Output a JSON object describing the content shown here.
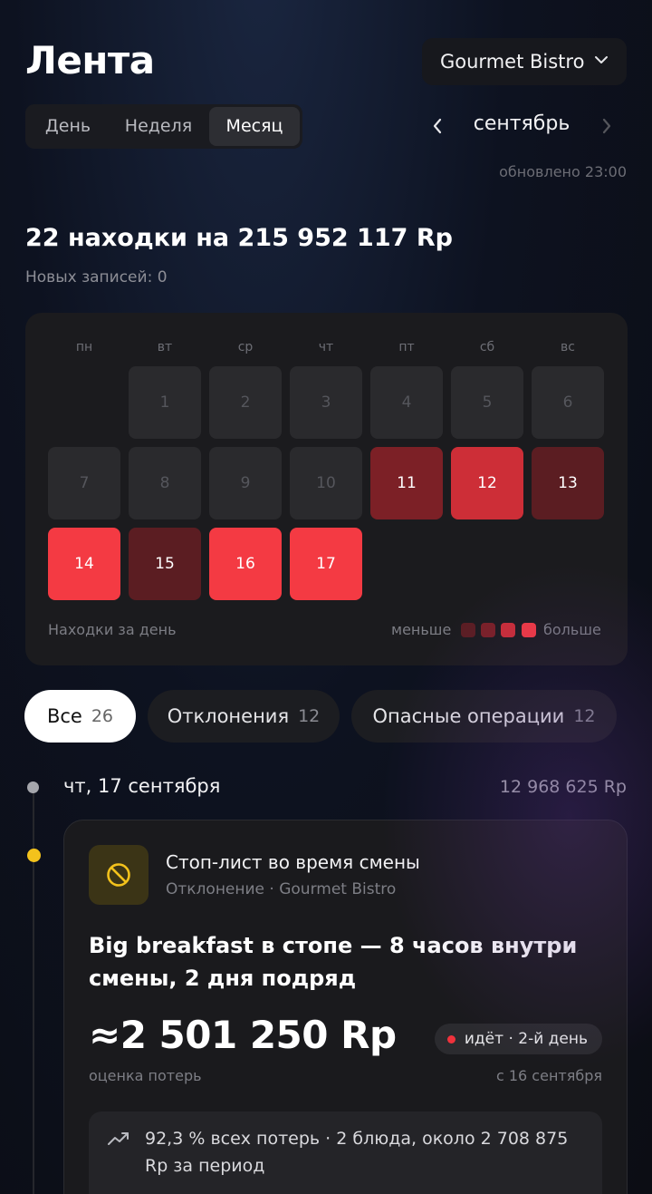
{
  "header": {
    "title": "Лента",
    "venue": "Gourmet Bistro"
  },
  "period_tabs": [
    "День",
    "Неделя",
    "Месяц"
  ],
  "active_period": "Месяц",
  "month": "сентябрь",
  "updated": "обновлено 23:00",
  "summary": {
    "headline": "22 находки на 215 952 117 Rp",
    "new_records": "Новых записей: 0"
  },
  "calendar": {
    "weekdays": [
      "пн",
      "вт",
      "ср",
      "чт",
      "пт",
      "сб",
      "вс"
    ],
    "days": [
      "1",
      "2",
      "3",
      "4",
      "5",
      "6",
      "7",
      "8",
      "9",
      "10",
      "11",
      "12",
      "13",
      "14",
      "15",
      "16",
      "17"
    ],
    "footer_label": "Находки за день",
    "legend_less": "меньше",
    "legend_more": "больше",
    "heat_colors": [
      "#5b1d22",
      "#7c2026",
      "#cd2e37",
      "#f43a43"
    ]
  },
  "filters": [
    {
      "label": "Все",
      "count": "26"
    },
    {
      "label": "Отклонения",
      "count": "12"
    },
    {
      "label": "Опасные операции",
      "count": "12"
    }
  ],
  "feed": {
    "date": "чт, 17 сентября",
    "date_total": "12 968 625 Rp",
    "card": {
      "icon": "no-entry-icon",
      "heading": "Стоп-лист во время смены",
      "subheading": "Отклонение · Gourmet Bistro",
      "title": "Big breakfast в стопе — 8 часов внутри смены, 2 дня подряд",
      "amount": "≈2 501 250 Rp",
      "amount_caption": "оценка потерь",
      "status": "идёт · 2-й день",
      "since": "с 16 сентября",
      "insight": "92,3 % всех потерь · 2 блюда, около 2 708 875 Rp за период"
    }
  }
}
